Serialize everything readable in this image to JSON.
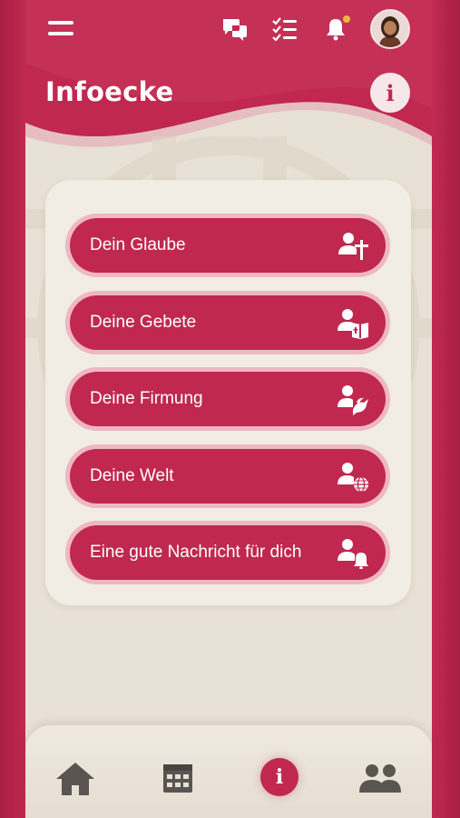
{
  "header": {
    "title": "Infoecke",
    "info_glyph": "i",
    "icons": {
      "menu": "hamburger-menu-icon",
      "chat": "chat-bubbles-icon",
      "checklist": "checklist-icon",
      "notifications": "bell-icon",
      "profile": "avatar"
    },
    "notification_dot_color": "#f4b43c"
  },
  "menu": {
    "items": [
      {
        "label": "Dein Glaube",
        "icon": "person-cross-icon"
      },
      {
        "label": "Deine Gebete",
        "icon": "person-bible-icon"
      },
      {
        "label": "Deine Firmung",
        "icon": "person-dove-icon"
      },
      {
        "label": "Deine Welt",
        "icon": "person-globe-icon"
      },
      {
        "label": "Eine gute Nachricht für dich",
        "icon": "person-bell-icon"
      }
    ]
  },
  "bottom_nav": {
    "items": [
      {
        "icon": "home-icon",
        "active": false
      },
      {
        "icon": "calendar-icon",
        "active": false
      },
      {
        "icon": "info-icon",
        "active": true,
        "glyph": "i"
      },
      {
        "icon": "group-icon",
        "active": false
      }
    ]
  },
  "colors": {
    "primary": "#c0284f",
    "button_ring": "#eeb7c3",
    "background": "#e8e1d5",
    "card": "#f1ece4",
    "nav_icon": "#5b5552"
  }
}
